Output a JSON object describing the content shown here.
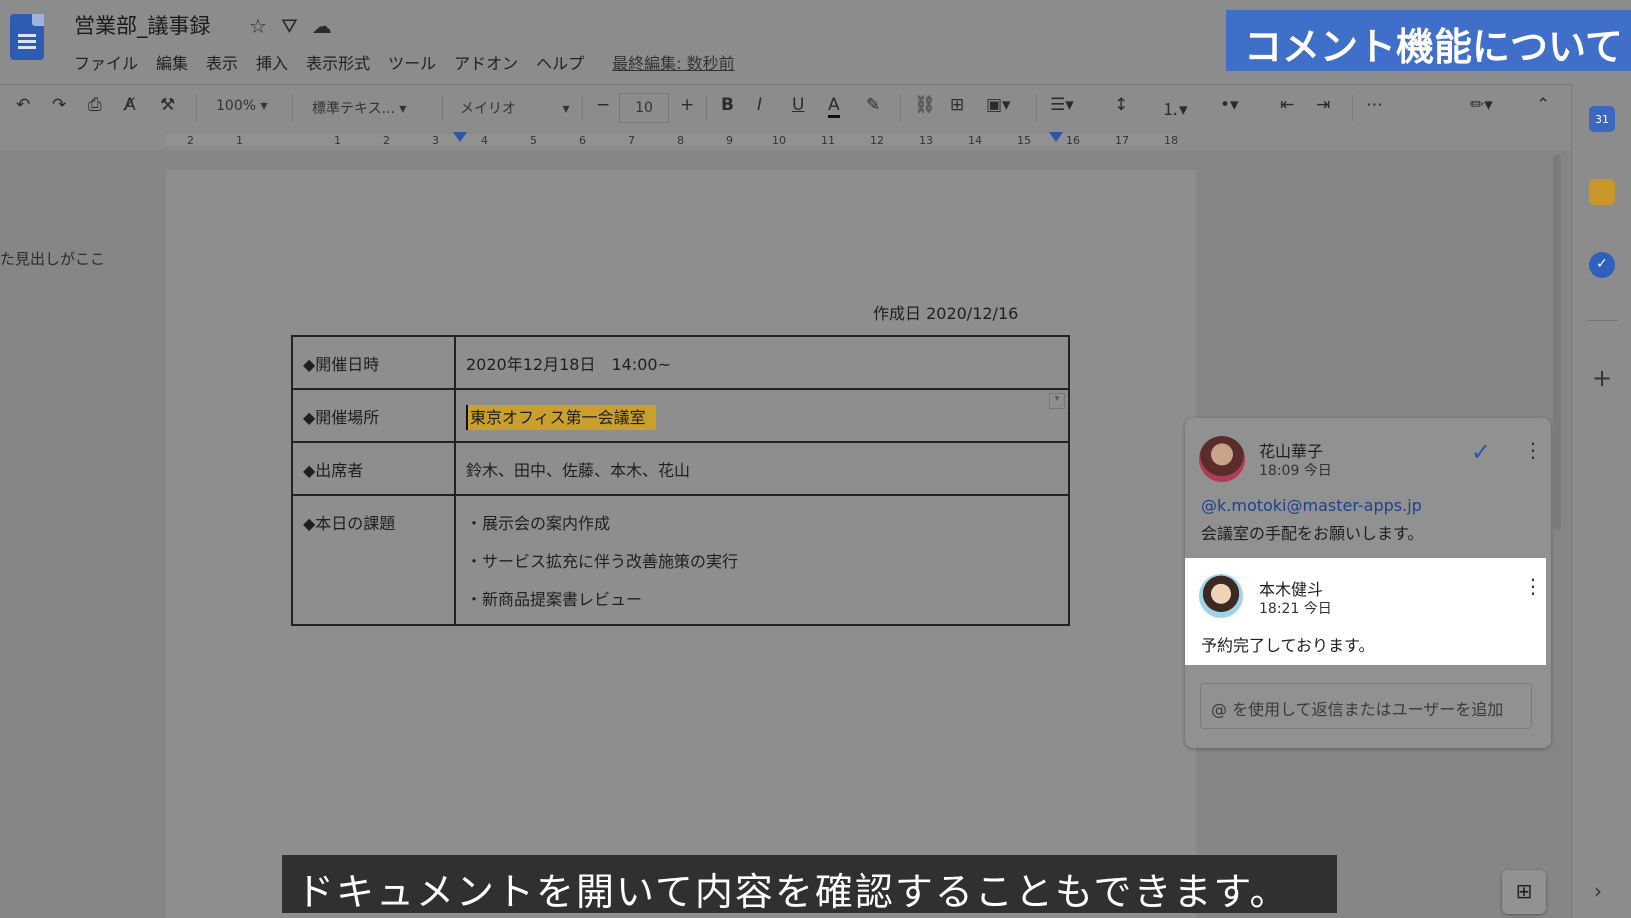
{
  "doc": {
    "title": "営業部_議事録",
    "menu": [
      "ファイル",
      "編集",
      "表示",
      "挿入",
      "表示形式",
      "ツール",
      "アドオン",
      "ヘルプ"
    ],
    "last_edit": "最終編集: 数秒前"
  },
  "banner": "コメント機能について",
  "toolbar": {
    "zoom": "100%",
    "style": "標準テキス...",
    "font": "メイリオ",
    "font_size": "10",
    "font_size_minus": "−",
    "font_size_plus": "+"
  },
  "ruler_numbers": [
    "2",
    "1",
    "1",
    "2",
    "3",
    "4",
    "5",
    "6",
    "7",
    "8",
    "9",
    "10",
    "11",
    "12",
    "13",
    "14",
    "15",
    "16",
    "17",
    "18"
  ],
  "outline_text": "た見出しがここ",
  "page": {
    "created_date": "作成日 2020/12/16",
    "table": [
      {
        "label": "◆開催日時",
        "value": "2020年12月18日　14:00~"
      },
      {
        "label": "◆開催場所",
        "value": "東京オフィス第一会議室"
      },
      {
        "label": "◆出席者",
        "value": "鈴木、田中、佐藤、本木、花山"
      },
      {
        "label": "◆本日の課題",
        "items": [
          "・展示会の案内作成",
          "・サービス拡充に伴う改善施策の実行",
          "・新商品提案書レビュー"
        ]
      }
    ]
  },
  "comments": {
    "first": {
      "author": "花山華子",
      "time": "18:09 今日",
      "mention": "@k.motoki@master-apps.jp",
      "text": "会議室の手配をお願いします。"
    },
    "reply": {
      "author": "本木健斗",
      "time": "18:21 今日",
      "text": "予約完了しております。"
    },
    "reply_placeholder": "@ を使用して返信またはユーザーを追加"
  },
  "side_panel": {
    "calendar_label": "31"
  },
  "subtitle": "ドキュメントを開いて内容を確認することもできます。",
  "colors": {
    "accent_blue": "#3f6fc8",
    "highlight": "#c9a02e",
    "subtitle_bg": "#303030"
  }
}
